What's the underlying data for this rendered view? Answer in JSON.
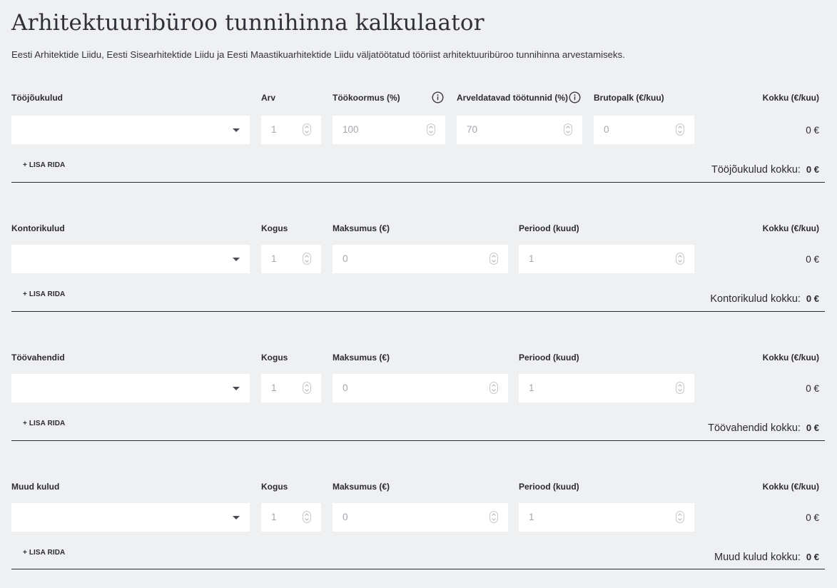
{
  "page": {
    "title": "Arhitektuuribüroo tunnihinna kalkulaator",
    "subtitle": "Eesti Arhitektide Liidu, Eesti Sisearhitektide Liidu ja Eesti Maastikuarhitektide Liidu väljatöötatud tööriist arhitektuuribüroo tunnihinna arvestamiseks."
  },
  "labor": {
    "header": "Tööjõukulud",
    "col_count": "Arv",
    "col_workload": "Töökoormus (%)",
    "col_billable": "Arveldatavad töötunnid (%)",
    "col_salary": "Brutopalk (€/kuu)",
    "col_total": "Kokku (€/kuu)",
    "count_value": "1",
    "workload_value": "100",
    "billable_value": "70",
    "salary_value": "0",
    "row_total": "0 €",
    "add_row": "+ LISA RIDA",
    "sum_label": "Tööjõukulud kokku:",
    "sum_value": "0 €"
  },
  "office": {
    "header": "Kontorikulud",
    "col_qty": "Kogus",
    "col_cost": "Maksumus (€)",
    "col_period": "Periood (kuud)",
    "col_total": "Kokku (€/kuu)",
    "qty_value": "1",
    "cost_value": "0",
    "period_value": "1",
    "row_total": "0 €",
    "add_row": "+ LISA RIDA",
    "sum_label": "Kontorikulud kokku:",
    "sum_value": "0 €"
  },
  "tools": {
    "header": "Töövahendid",
    "col_qty": "Kogus",
    "col_cost": "Maksumus (€)",
    "col_period": "Periood (kuud)",
    "col_total": "Kokku (€/kuu)",
    "qty_value": "1",
    "cost_value": "0",
    "period_value": "1",
    "row_total": "0 €",
    "add_row": "+ LISA RIDA",
    "sum_label": "Töövahendid kokku:",
    "sum_value": "0 €"
  },
  "other": {
    "header": "Muud kulud",
    "col_qty": "Kogus",
    "col_cost": "Maksumus (€)",
    "col_period": "Periood (kuud)",
    "col_total": "Kokku (€/kuu)",
    "qty_value": "1",
    "cost_value": "0",
    "period_value": "1",
    "row_total": "0 €",
    "add_row": "+ LISA RIDA",
    "sum_label": "Muud kulud kokku:",
    "sum_value": "0 €"
  },
  "icons": {
    "info": "info-icon",
    "dropdown": "chevron-down-icon",
    "spinner": "spinner-icon"
  },
  "colors": {
    "background": "#eff0f2",
    "field": "#ffffff",
    "text": "#2b2c31",
    "placeholder": "#a4a6ac"
  }
}
